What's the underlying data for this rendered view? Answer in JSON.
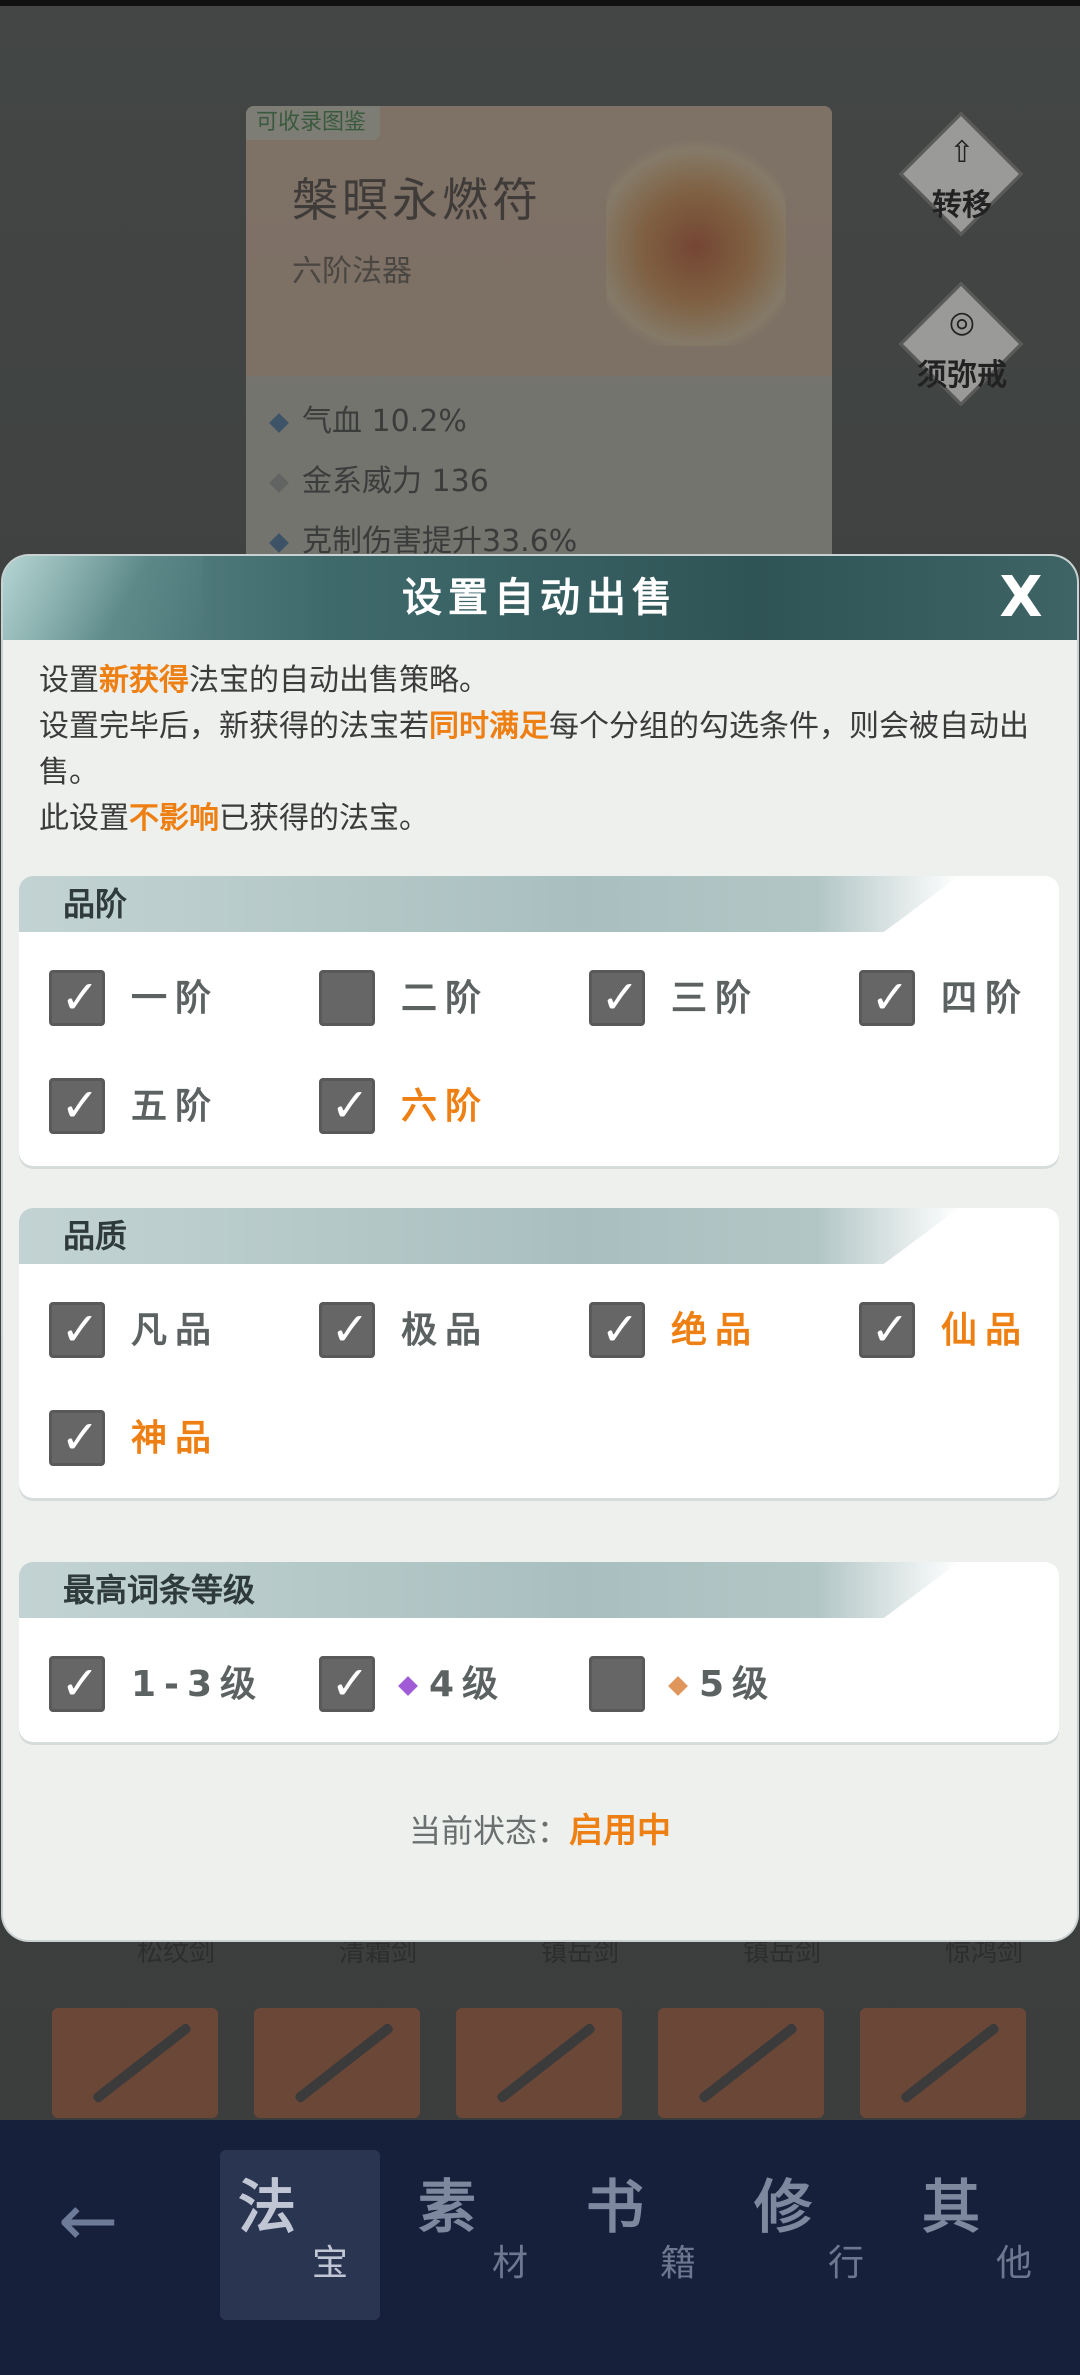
{
  "background": {
    "item_card": {
      "collect_tag": "可收录图鉴",
      "name": "槃暝永燃符",
      "tier": "六阶法器",
      "stats": [
        "气血 10.2%",
        "金系威力 136",
        "克制伤害提升33.6%"
      ]
    },
    "side_buttons": [
      {
        "label": "转移",
        "icon": "upload-icon"
      },
      {
        "label": "须弥戒",
        "icon": "ring-icon"
      }
    ],
    "list_names": [
      "松纹剑",
      "清霜剑",
      "镇岳剑",
      "镇岳剑",
      "惊鸿剑"
    ],
    "bottom_nav": {
      "back": "←",
      "tabs": [
        {
          "big": "法",
          "small": "宝",
          "active": true
        },
        {
          "big": "素",
          "small": "材",
          "active": false
        },
        {
          "big": "书",
          "small": "籍",
          "active": false
        },
        {
          "big": "修",
          "small": "行",
          "active": false
        },
        {
          "big": "其",
          "small": "他",
          "active": false
        }
      ]
    }
  },
  "modal": {
    "title": "设置自动出售",
    "close": "X",
    "desc": {
      "l1_a": "设置",
      "l1_hl": "新获得",
      "l1_b": "法宝的自动出售策略。",
      "l2_a": "设置完毕后，新获得的法宝若",
      "l2_hl": "同时满足",
      "l2_b": "每个分组的勾选条件，则会被自动出售。",
      "l3_a": "此设置",
      "l3_hl": "不影响",
      "l3_b": "已获得的法宝。"
    },
    "groups": {
      "tier": {
        "title": "品阶",
        "options": [
          {
            "label": "一阶",
            "checked": true,
            "color": "gray"
          },
          {
            "label": "二阶",
            "checked": false,
            "color": "gray"
          },
          {
            "label": "三阶",
            "checked": true,
            "color": "gray"
          },
          {
            "label": "四阶",
            "checked": true,
            "color": "gray"
          },
          {
            "label": "五阶",
            "checked": true,
            "color": "gray"
          },
          {
            "label": "六阶",
            "checked": true,
            "color": "orange"
          }
        ]
      },
      "quality": {
        "title": "品质",
        "options": [
          {
            "label": "凡品",
            "checked": true,
            "color": "gray"
          },
          {
            "label": "极品",
            "checked": true,
            "color": "gray"
          },
          {
            "label": "绝品",
            "checked": true,
            "color": "orange"
          },
          {
            "label": "仙品",
            "checked": true,
            "color": "orange"
          },
          {
            "label": "神品",
            "checked": true,
            "color": "orange"
          }
        ]
      },
      "level": {
        "title": "最高词条等级",
        "options": [
          {
            "label": "1-3级",
            "checked": true,
            "diamond": ""
          },
          {
            "label": "4级",
            "checked": true,
            "diamond": "#a25bd6"
          },
          {
            "label": "5级",
            "checked": false,
            "diamond": "#e0955a"
          }
        ]
      }
    },
    "status": {
      "label": "当前状态：",
      "value": "启用中"
    },
    "colors": {
      "accent": "#ee7f12",
      "header": "#3f6a6c",
      "checkbox": "#666666"
    }
  }
}
